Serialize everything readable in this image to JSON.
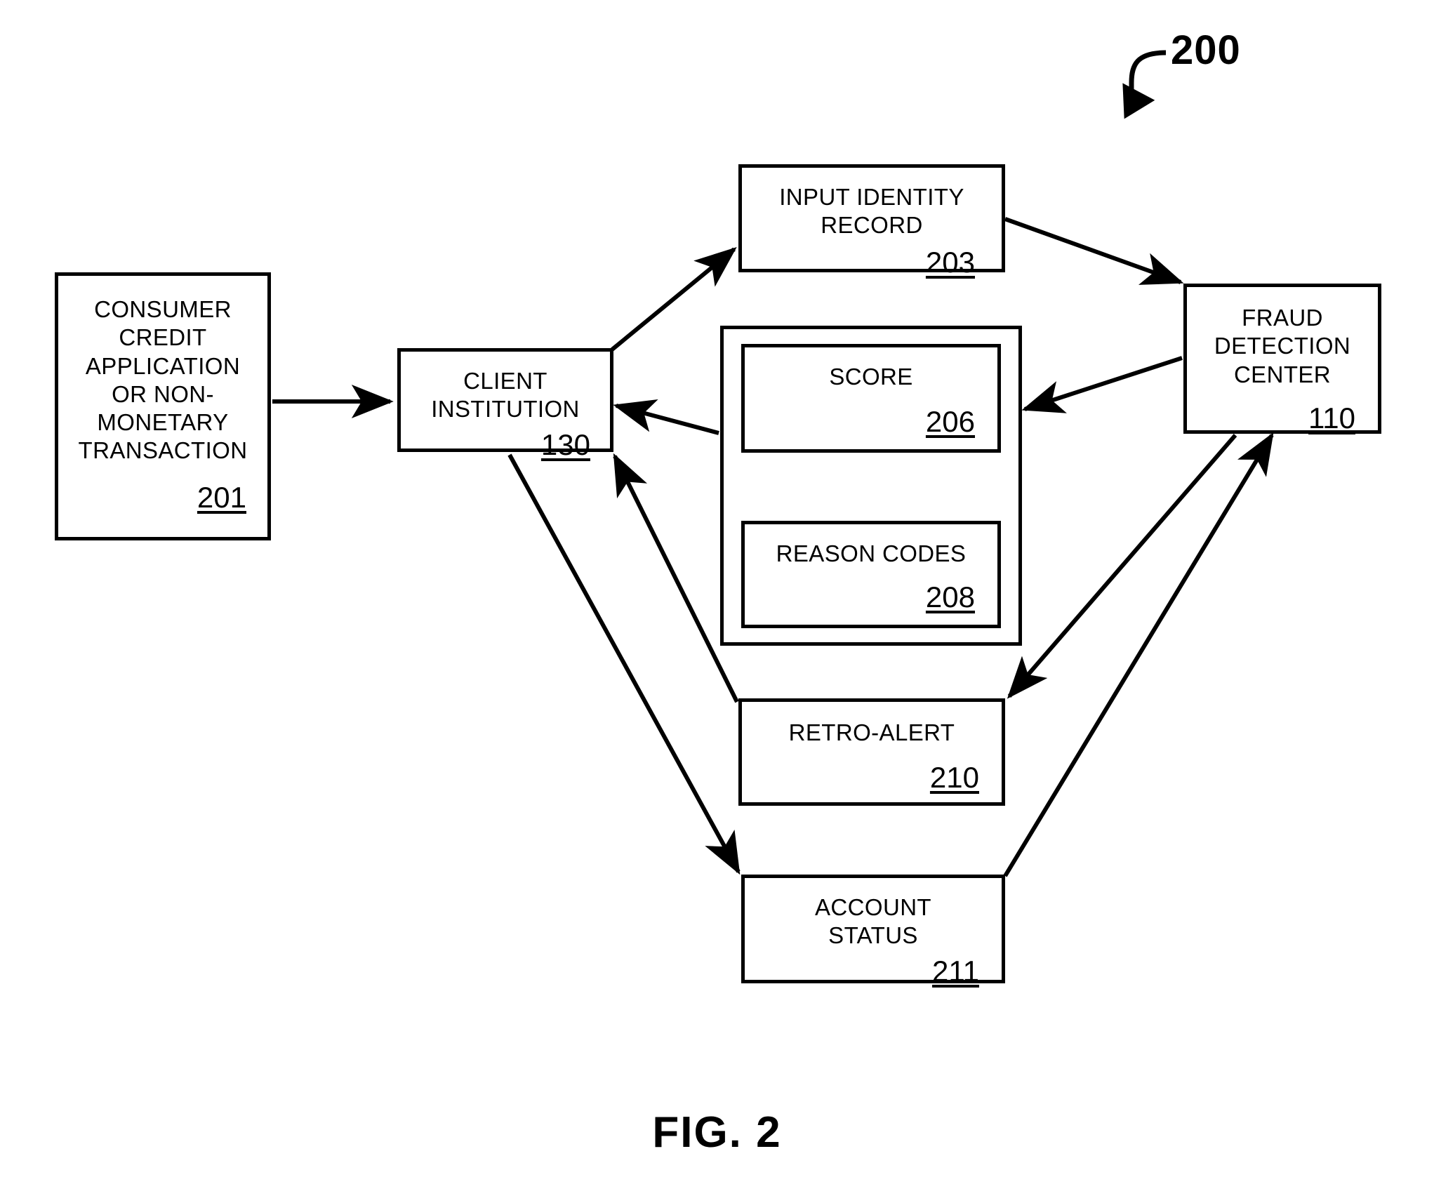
{
  "figure": {
    "caption": "FIG. 2",
    "diagram_ref": "200"
  },
  "nodes": [
    {
      "id": "box-201",
      "label": "CONSUMER\nCREDIT\nAPPLICATION\nOR NON-\nMONETARY\nTRANSACTION",
      "ref": "201"
    },
    {
      "id": "box-130",
      "label": "CLIENT\nINSTITUTION",
      "ref": "130"
    },
    {
      "id": "box-203",
      "label": "INPUT IDENTITY\nRECORD",
      "ref": "203"
    },
    {
      "id": "box-110",
      "label": "FRAUD\nDETECTION\nCENTER",
      "ref": "110"
    },
    {
      "id": "box-206",
      "label": "SCORE",
      "ref": "206"
    },
    {
      "id": "box-208",
      "label": "REASON CODES",
      "ref": "208"
    },
    {
      "id": "box-210",
      "label": "RETRO-ALERT",
      "ref": "210"
    },
    {
      "id": "box-211",
      "label": "ACCOUNT\nSTATUS",
      "ref": "211"
    }
  ],
  "connectors": [
    {
      "name": "arrow-transaction-to-client-institution",
      "from": "201",
      "to": "130"
    },
    {
      "name": "arrow-client-institution-to-input-identity-record",
      "from": "130",
      "to": "203"
    },
    {
      "name": "arrow-input-identity-record-to-fraud-detection-center",
      "from": "203",
      "to": "110"
    },
    {
      "name": "arrow-fraud-detection-center-to-score",
      "from": "110",
      "to": "206"
    },
    {
      "name": "arrow-score-to-client-institution",
      "from": "206",
      "to": "130"
    },
    {
      "name": "arrow-fraud-detection-center-to-retro-alert",
      "from": "110",
      "to": "210"
    },
    {
      "name": "arrow-retro-alert-to-client-institution",
      "from": "210",
      "to": "130"
    },
    {
      "name": "arrow-client-institution-to-account-status",
      "from": "130",
      "to": "211"
    },
    {
      "name": "arrow-account-status-to-fraud-detection-center",
      "from": "211",
      "to": "110"
    }
  ],
  "colors": {
    "stroke": "#000000",
    "background": "#ffffff"
  }
}
